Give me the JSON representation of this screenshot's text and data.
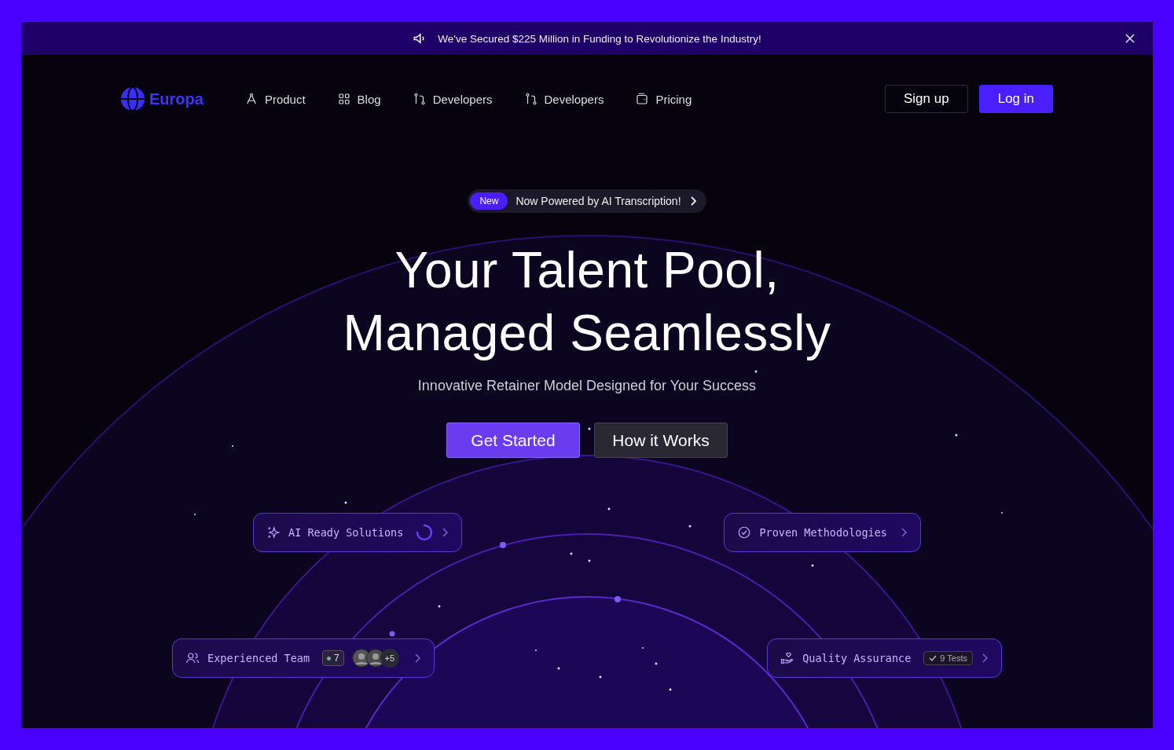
{
  "banner": {
    "text": "We've Secured $225 Million in Funding to Revolutionize the Industry!"
  },
  "brand": {
    "name": "Europa"
  },
  "nav": [
    {
      "label": "Product"
    },
    {
      "label": "Blog"
    },
    {
      "label": "Developers"
    },
    {
      "label": "Developers"
    },
    {
      "label": "Pricing"
    }
  ],
  "auth": {
    "signup": "Sign up",
    "login": "Log in"
  },
  "announcement": {
    "badge": "New",
    "text": "Now Powered by AI Transcription!"
  },
  "hero": {
    "title_lines": [
      "Your Talent Pool,",
      "Managed Seamlessly"
    ],
    "subtitle": "Innovative Retainer Model Designed for Your Success"
  },
  "cta": {
    "primary": "Get Started",
    "secondary": "How it Works"
  },
  "features": [
    {
      "kind": "spinner",
      "label": "AI Ready Solutions"
    },
    {
      "kind": "plain",
      "label": "Proven Methodologies"
    },
    {
      "kind": "team",
      "label": "Experienced Team",
      "count": "7",
      "more": "+5"
    },
    {
      "kind": "badge",
      "label": "Quality Assurance",
      "badge": "9 Tests"
    }
  ]
}
